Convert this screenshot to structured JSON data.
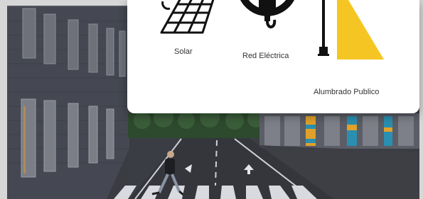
{
  "options": [
    {
      "id": "solar",
      "label": "Solar",
      "icon": "solar-panel-icon"
    },
    {
      "id": "grid",
      "label": "Red Eléctrica",
      "icon": "power-plug-icon"
    },
    {
      "id": "streetlight",
      "label": "Alumbrado Publico",
      "icon": "street-lamp-icon"
    }
  ],
  "colors": {
    "panel_bg": "#ffffff",
    "icon_dark": "#111111",
    "lamp_light": "#f5c623",
    "label_text": "#333333"
  }
}
